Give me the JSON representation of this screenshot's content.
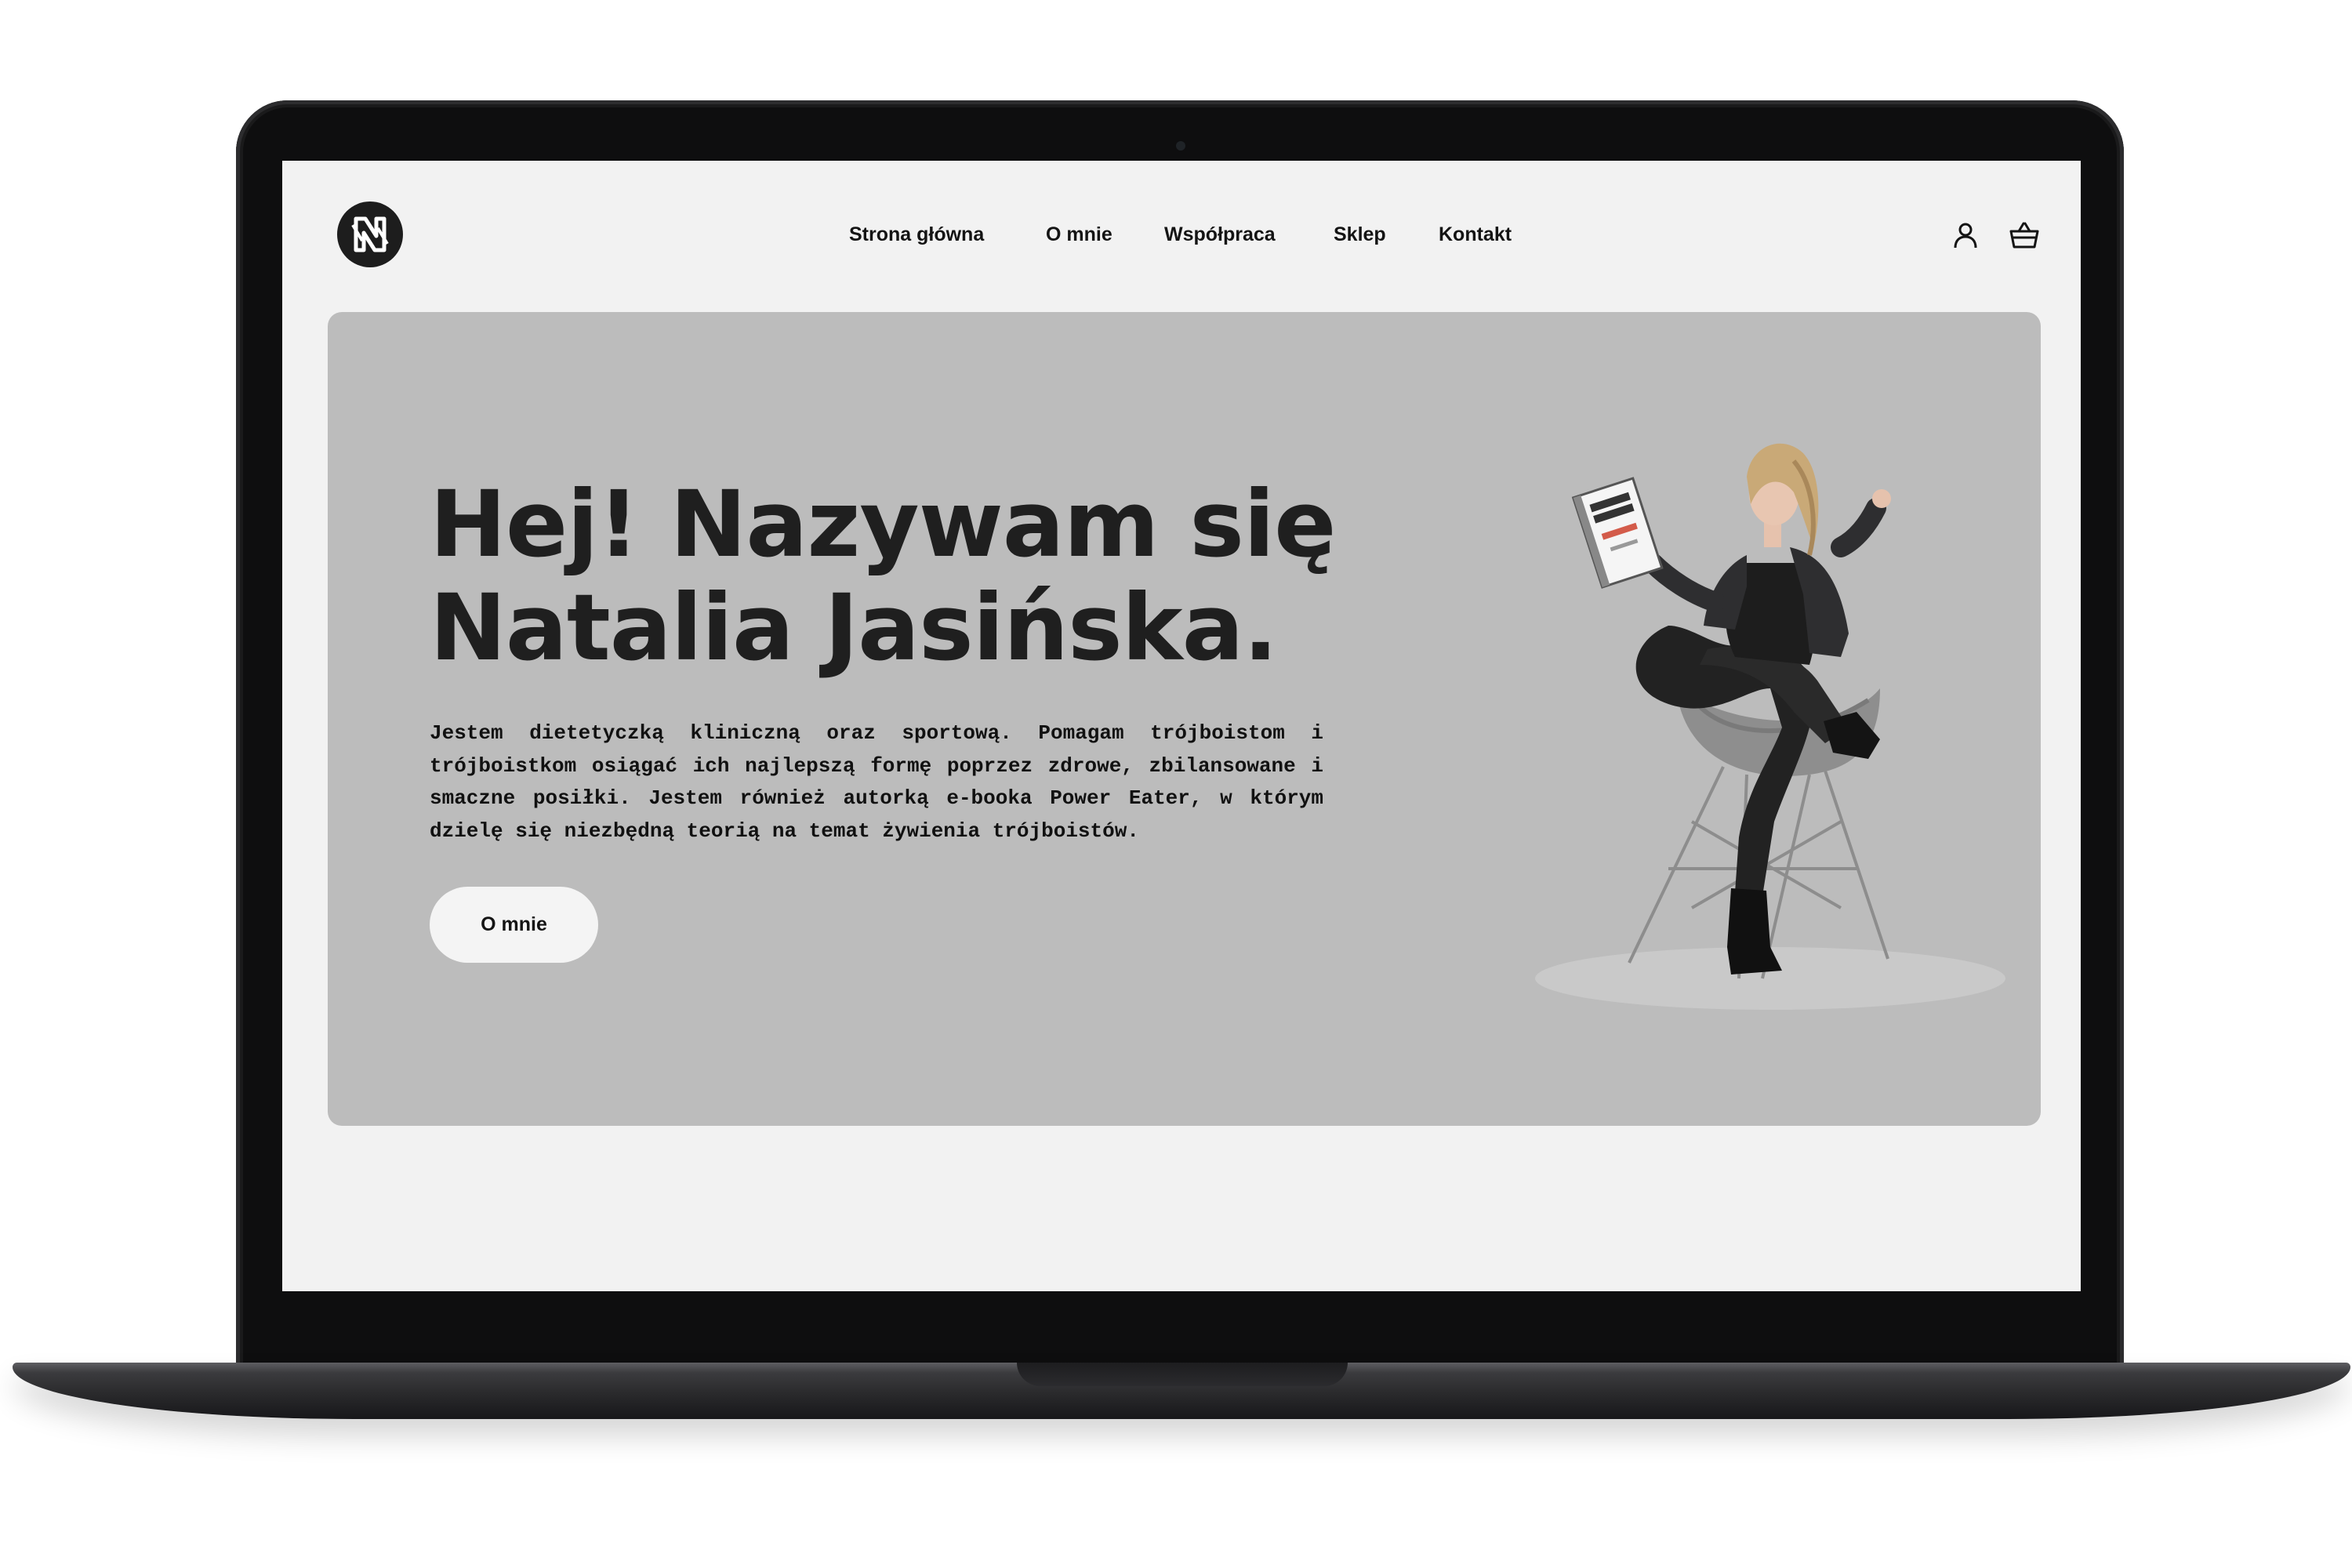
{
  "brand": {
    "logo_icon": "monogram-n-logo-icon"
  },
  "nav": {
    "items": [
      {
        "label": "Strona główna"
      },
      {
        "label": "O mnie"
      },
      {
        "label": "Współpraca"
      },
      {
        "label": "Sklep"
      },
      {
        "label": "Kontakt"
      }
    ],
    "account_icon": "user-icon",
    "cart_icon": "basket-icon"
  },
  "hero": {
    "heading_line1": "Hej! Nazywam się",
    "heading_line2": "Natalia Jasińska.",
    "description": "Jestem dietetyczką kliniczną oraz sportową. Pomagam trójboistom i trójboistkom osiągać ich najlepszą formę poprzez zdrowe, zbilansowane i smaczne posiłki. Jestem również autorką e-booka Power Eater, w którym dzielę się niezbędną teorią na temat żywienia trójboistów.",
    "cta_label": "O mnie",
    "photo_icon": "woman-reading-book-on-chair-photo"
  },
  "colors": {
    "screen_bg": "#f2f2f2",
    "hero_bg": "#bcbcbc",
    "text_dark": "#1f1f1f",
    "button_bg": "#f4f4f4",
    "laptop_frame": "#0e0e0f"
  }
}
